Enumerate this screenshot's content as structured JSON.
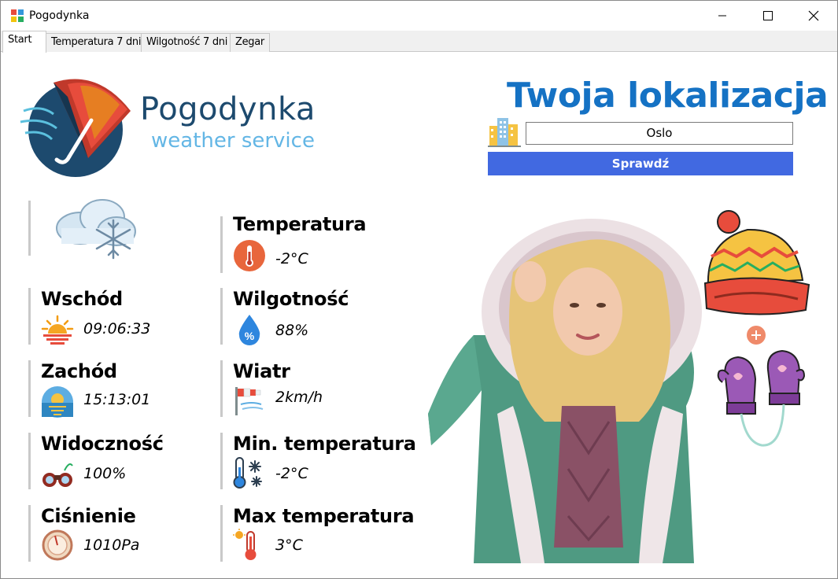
{
  "window": {
    "title": "Pogodynka"
  },
  "tabs": [
    {
      "label": "Start"
    },
    {
      "label": "Temperatura 7 dni"
    },
    {
      "label": "Wilgotność 7 dni"
    },
    {
      "label": "Zegar"
    }
  ],
  "logo": {
    "title": "Pogodynka",
    "subtitle": "weather service"
  },
  "location": {
    "title": "Twoja lokalizacja",
    "city_value": "Oslo",
    "check_label": "Sprawdź"
  },
  "weather": {
    "temperature": {
      "label": "Temperatura",
      "value": "-2°C"
    },
    "sunrise": {
      "label": "Wschód",
      "value": "09:06:33"
    },
    "humidity": {
      "label": "Wilgotność",
      "value": "88%"
    },
    "sunset": {
      "label": "Zachód",
      "value": "15:13:01"
    },
    "wind": {
      "label": "Wiatr",
      "value": "2km/h"
    },
    "visibility": {
      "label": "Widoczność",
      "value": "100%"
    },
    "min_temp": {
      "label": "Min. temperatura",
      "value": "-2°C"
    },
    "pressure": {
      "label": "Ciśnienie",
      "value": "1010Pa"
    },
    "max_temp": {
      "label": "Max temperatura",
      "value": "3°C"
    }
  },
  "icons": {
    "condition": "snow-cloud-icon",
    "temperature": "thermometer-icon",
    "sunrise": "sunrise-icon",
    "humidity": "humidity-drop-icon",
    "sunset": "sunset-icon",
    "wind": "wind-icon",
    "visibility": "binoculars-icon",
    "min_temp": "cold-thermometer-icon",
    "pressure": "barometer-icon",
    "max_temp": "hot-thermometer-icon",
    "city": "city-buildings-icon"
  },
  "colors": {
    "accent_blue": "#1572c4",
    "button_blue": "#4169e1",
    "logo_dark": "#1d4a6e",
    "logo_light": "#63b6e5"
  }
}
